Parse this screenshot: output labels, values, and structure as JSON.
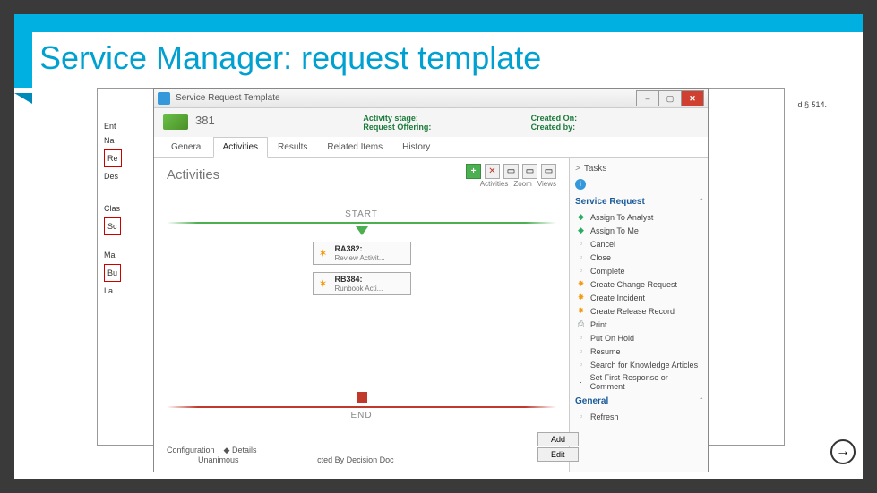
{
  "slide": {
    "title": "Service Manager: request template"
  },
  "window": {
    "title": "Service Request Template",
    "id": "381",
    "labels": {
      "activity_stage": "Activity stage:",
      "request_offering": "Request Offering:",
      "created_on": "Created On:",
      "created_by": "Created by:"
    }
  },
  "tabs": [
    "General",
    "Activities",
    "Results",
    "Related Items",
    "History"
  ],
  "active_tab": 1,
  "section_heading": "Activities",
  "toolbar_labels": [
    "Activities",
    "Zoom",
    "Views"
  ],
  "flow": {
    "start": "START",
    "end": "END",
    "activities": [
      {
        "id": "RA382:",
        "desc": "Review Activit..."
      },
      {
        "id": "RB384:",
        "desc": "Runbook Acti..."
      }
    ]
  },
  "tasks": {
    "header": "Tasks",
    "section1": "Service Request",
    "items1": [
      {
        "icon": "grn",
        "label": "Assign To Analyst"
      },
      {
        "icon": "grn",
        "label": "Assign To Me"
      },
      {
        "icon": "gry",
        "label": "Cancel"
      },
      {
        "icon": "gry",
        "label": "Close"
      },
      {
        "icon": "gry",
        "label": "Complete"
      },
      {
        "icon": "org",
        "label": "Create Change Request"
      },
      {
        "icon": "org",
        "label": "Create Incident"
      },
      {
        "icon": "org",
        "label": "Create Release Record"
      },
      {
        "icon": "prn",
        "label": "Print"
      },
      {
        "icon": "gry",
        "label": "Put On Hold"
      },
      {
        "icon": "gry",
        "label": "Resume"
      },
      {
        "icon": "gry",
        "label": "Search for Knowledge Articles"
      },
      {
        "icon": "",
        "label": "Set First Response or Comment"
      }
    ],
    "section2": "General",
    "items2": [
      {
        "icon": "gry",
        "label": "Refresh"
      }
    ]
  },
  "fragments": {
    "left": [
      "Ent",
      "Na",
      "Re",
      "Des",
      "Clas",
      "Sc",
      "Ma",
      "Bu",
      "La"
    ],
    "right": "d § 514.",
    "config": "Configuration",
    "details": "Details",
    "unan": "Unanimous",
    "cols": "cted By      Decision      Doc",
    "add": "Add",
    "edit": "Edit"
  }
}
